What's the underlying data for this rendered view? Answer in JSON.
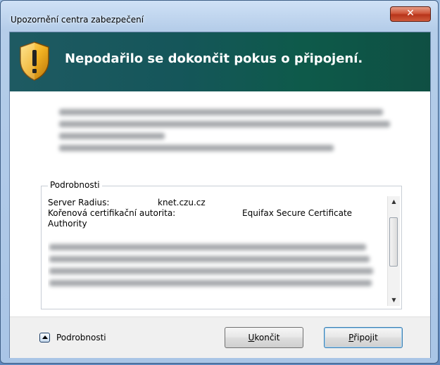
{
  "window": {
    "title": "Upozornění centra zabezpečení",
    "close_icon": "close-x-icon"
  },
  "banner": {
    "icon": "warning-shield-icon",
    "title": "Nepodařilo se dokončit pokus o připojení."
  },
  "details": {
    "group_title": "Podrobnosti",
    "server_label": "Server Radius:",
    "server_value": "knet.czu.cz",
    "ca_label": "Kořenová certifikační autorita:",
    "ca_value": "Equifax Secure Certificate",
    "ca_value_cont": "Authority"
  },
  "footer": {
    "expander_label": "Podrobnosti",
    "cancel_button": {
      "mnemonic": "U",
      "rest": "končit"
    },
    "connect_button": {
      "mnemonic": "P",
      "rest": "řipojit"
    }
  },
  "colors": {
    "banner": "#15565a",
    "close_button": "#c9472b",
    "shield": "#f0b021"
  }
}
